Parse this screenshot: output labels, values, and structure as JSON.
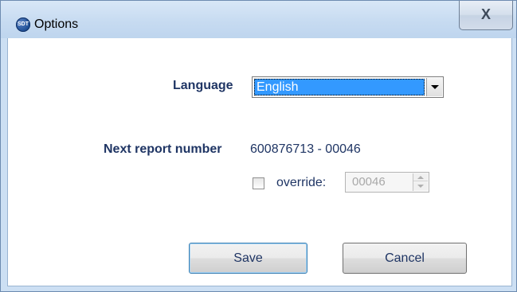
{
  "window": {
    "title": "Options",
    "app_icon_text": "SDT",
    "close_glyph": "X"
  },
  "language": {
    "label": "Language",
    "selected": "English"
  },
  "report": {
    "label": "Next report number",
    "value": "600876713  -  00046"
  },
  "override": {
    "label": "override:",
    "checked": false,
    "value": "00046"
  },
  "buttons": {
    "save": "Save",
    "cancel": "Cancel"
  },
  "colors": {
    "label_text": "#1f3564",
    "selection": "#3399ff",
    "titlebar": "#c7dbf1"
  },
  "icons": {
    "app": "sdt-logo-icon",
    "close": "close-icon",
    "dropdown": "chevron-down-icon",
    "spin_up": "spin-up-icon",
    "spin_down": "spin-down-icon"
  }
}
